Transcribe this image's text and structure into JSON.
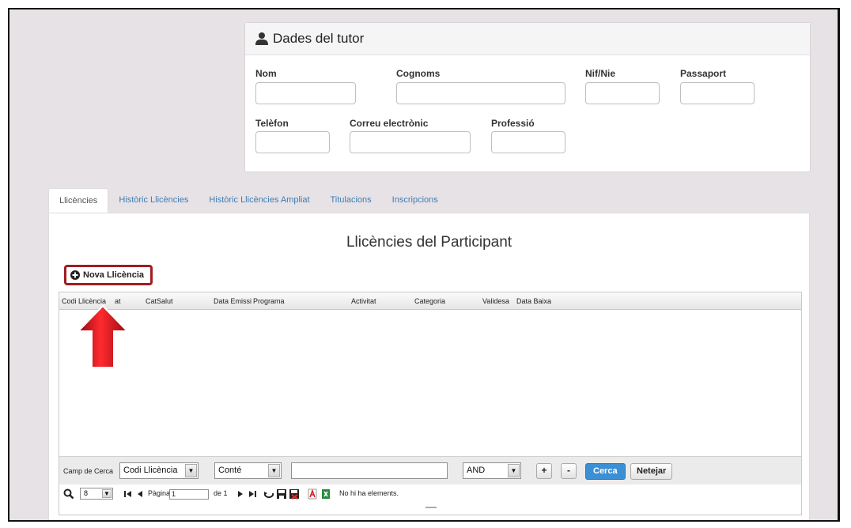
{
  "tutor": {
    "title": "Dades del tutor",
    "fields": {
      "nom": "Nom",
      "cognoms": "Cognoms",
      "nif": "Nif/Nie",
      "passaport": "Passaport",
      "telefon": "Telèfon",
      "correu": "Correu electrònic",
      "professio": "Professió"
    }
  },
  "tabs": [
    "Llicències",
    "Històric Llicències",
    "Històric Llicències Ampliat",
    "Titulacions",
    "Inscripcions"
  ],
  "panel": {
    "title": "Llicències del Participant",
    "new_button": "Nova Llicència"
  },
  "grid": {
    "columns": [
      "Codi Llicència",
      "at",
      "CatSalut",
      "Data Emissi",
      "Programa",
      "Activitat",
      "Categoria",
      "Validesa",
      "Data Baixa"
    ]
  },
  "search": {
    "label": "Camp de Cerca",
    "field_select": "Codi Llicència",
    "operator_select": "Conté",
    "value": "",
    "logic_select": "AND",
    "plus": "+",
    "minus": "-",
    "cerca": "Cerca",
    "netejar": "Netejar"
  },
  "pager": {
    "page_size": "8",
    "page_label": "Pàgina",
    "page_value": "1",
    "of_label": "de 1",
    "status": "No hi ha elements."
  },
  "colors": {
    "accent": "#3b8fd4",
    "highlight": "#a01d22",
    "arrow": "#e0141c"
  }
}
